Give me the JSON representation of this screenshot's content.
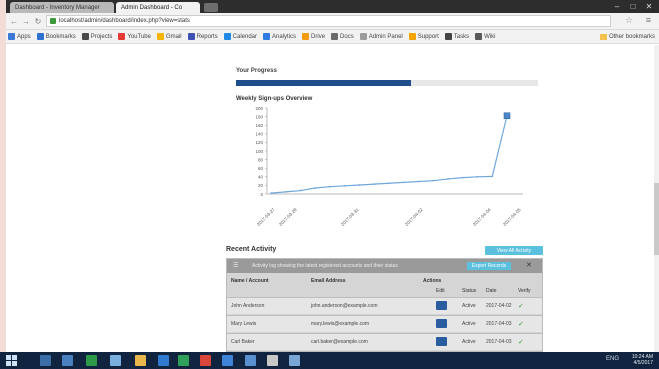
{
  "browser": {
    "tabs": [
      {
        "label": "Dashboard - Inventory Manager",
        "active": false
      },
      {
        "label": "Admin Dashboard - Co",
        "active": true
      }
    ],
    "url": "localhost/admin/dashboard/index.php?view=stats",
    "bookmarks": [
      {
        "label": "Apps",
        "color": "#3a79d6"
      },
      {
        "label": "Bookmarks",
        "color": "#2f6fd0"
      },
      {
        "label": "Projects",
        "color": "#4a4a4a"
      },
      {
        "label": "YouTube",
        "color": "#e53935"
      },
      {
        "label": "Gmail",
        "color": "#f5b400"
      },
      {
        "label": "Reports",
        "color": "#3f51b5"
      },
      {
        "label": "Calendar",
        "color": "#1e88e5"
      },
      {
        "label": "Analytics",
        "color": "#2d7be0"
      },
      {
        "label": "Drive",
        "color": "#f39c12"
      },
      {
        "label": "Docs",
        "color": "#6a6a6a"
      },
      {
        "label": "Admin Panel",
        "color": "#9c9c9c"
      },
      {
        "label": "Support",
        "color": "#f0a500"
      },
      {
        "label": "Tasks",
        "color": "#444444"
      },
      {
        "label": "Wiki",
        "color": "#5a5a5a"
      }
    ],
    "other_bookmarks": "Other bookmarks"
  },
  "page": {
    "progress_label": "Your Progress",
    "progress_fraction": 0.58,
    "chart_title": "Weekly Sign-ups Overview",
    "widget_title": "Recent Activity",
    "widget_button": "View All Activity",
    "panel": {
      "header_text": "Activity log showing the latest registered accounts and their status",
      "button": "Export Records",
      "columns": [
        "Name / Account",
        "Email Address",
        "Actions"
      ],
      "sub_columns": [
        "Edit",
        "Status",
        "Date",
        "Verify"
      ],
      "rows": [
        {
          "name": "John Anderson",
          "email": "john.anderson@example.com",
          "status": "Active",
          "date": "2017-04-02"
        },
        {
          "name": "Mary Lewis",
          "email": "mary.lewis@example.com",
          "status": "Active",
          "date": "2017-04-03"
        },
        {
          "name": "Carl Baker",
          "email": "carl.baker@example.com",
          "status": "Active",
          "date": "2017-04-03"
        }
      ]
    }
  },
  "chart_data": {
    "type": "line",
    "title": "Weekly Sign-ups Overview",
    "x": [
      "2017-03-27",
      "2017-03-28",
      "2017-03-31",
      "2017-04-02",
      "2017-04-04",
      "2017-04-05"
    ],
    "yticks": [
      0,
      20,
      40,
      60,
      80,
      100,
      120,
      140,
      160,
      180,
      200
    ],
    "ylim": [
      0,
      200
    ],
    "series": [
      {
        "values": [
          2,
          5,
          8,
          14,
          17,
          19,
          21,
          23,
          25,
          27,
          29,
          31,
          35,
          38,
          40,
          41,
          182
        ],
        "color": "#6fa8dc"
      }
    ],
    "grid": false,
    "legend": "none"
  },
  "taskbar": {
    "tray_text": "ENG",
    "time": "10:24 AM",
    "date": "4/5/2017"
  },
  "colors": {
    "progress_fill": "#1e4d8c",
    "accent": "#5bc0de",
    "taskbar": "#10243f"
  }
}
